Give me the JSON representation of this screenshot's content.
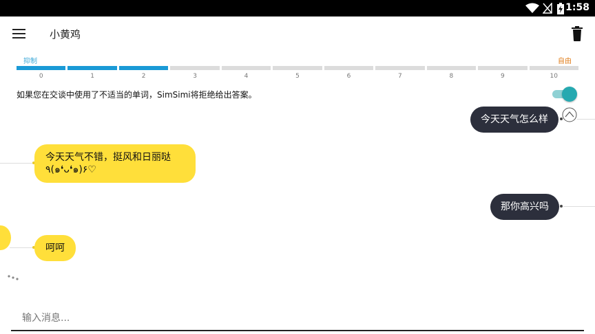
{
  "status_bar": {
    "time": "1:58",
    "icons": [
      "wifi-icon",
      "no-signal-icon",
      "battery-charging-icon"
    ]
  },
  "app_bar": {
    "title": "小黄鸡",
    "menu_icon": "menu-icon",
    "trash_icon": "trash-icon"
  },
  "filter": {
    "min_label": "抑制",
    "max_label": "自由",
    "level": 3,
    "ticks": [
      "0",
      "1",
      "2",
      "3",
      "4",
      "5",
      "6",
      "7",
      "8",
      "9",
      "10"
    ],
    "active_color": "#1a9ad6",
    "min_color": "#3ea9d8",
    "max_color": "#e07b16"
  },
  "notice": {
    "text": "如果您在交谈中使用了不适当的单词，SimSimi将拒绝给出答案。",
    "toggle_on": true
  },
  "messages": [
    {
      "from": "user",
      "text": "今天天气怎么样"
    },
    {
      "from": "bot",
      "line1": "今天天气不错，挺风和日丽哒",
      "line2": "٩(๑❛ᴗ❛๑)۶♡"
    },
    {
      "from": "user",
      "text": "那你高兴吗"
    },
    {
      "from": "bot",
      "text": "呵呵"
    }
  ],
  "input": {
    "placeholder": "输入消息...",
    "value": ""
  }
}
